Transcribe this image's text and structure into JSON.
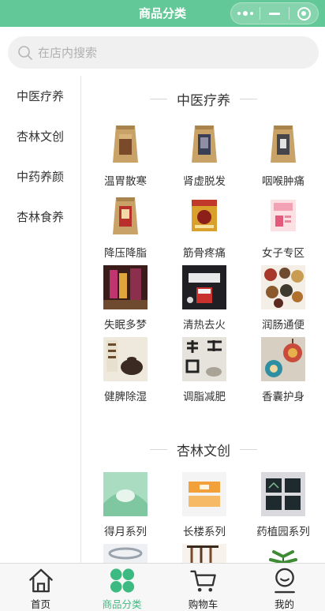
{
  "header": {
    "title": "商品分类"
  },
  "search": {
    "placeholder": "在店内搜索"
  },
  "sidebar": {
    "items": [
      {
        "label": "中医疗养"
      },
      {
        "label": "杏林文创"
      },
      {
        "label": "中药养颜"
      },
      {
        "label": "杏林食养"
      }
    ]
  },
  "sections": [
    {
      "title": "中医疗养",
      "items": [
        {
          "label": "温胃散寒",
          "icon": "herbal-tea-bag-icon"
        },
        {
          "label": "肾虚脱发",
          "icon": "herbal-tea-bag-icon"
        },
        {
          "label": "咽喉肿痛",
          "icon": "herbal-tea-bag-icon"
        },
        {
          "label": "降压降脂",
          "icon": "herbal-tea-bag-icon"
        },
        {
          "label": "筋骨疼痛",
          "icon": "medicine-box-icon"
        },
        {
          "label": "女子专区",
          "icon": "pink-box-icon"
        },
        {
          "label": "失眠多梦",
          "icon": "incense-photo-icon"
        },
        {
          "label": "清热去火",
          "icon": "tea-product-photo-icon"
        },
        {
          "label": "润肠通便",
          "icon": "dried-herbs-photo-icon"
        },
        {
          "label": "健脾除湿",
          "icon": "teapot-photo-icon"
        },
        {
          "label": "调脂减肥",
          "icon": "calligraphy-photo-icon"
        },
        {
          "label": "香囊护身",
          "icon": "sachet-photo-icon"
        }
      ]
    },
    {
      "title": "杏林文创",
      "items": [
        {
          "label": "得月系列",
          "icon": "green-artwork-icon"
        },
        {
          "label": "长楼系列",
          "icon": "orange-gift-box-icon"
        },
        {
          "label": "药植园系列",
          "icon": "dark-cards-icon"
        },
        {
          "label": "",
          "icon": "bracelet-photo-icon"
        },
        {
          "label": "",
          "icon": "brush-photo-icon"
        },
        {
          "label": "",
          "icon": "green-plant-icon"
        }
      ]
    }
  ],
  "tabbar": {
    "tabs": [
      {
        "label": "首页",
        "icon": "home-icon"
      },
      {
        "label": "商品分类",
        "icon": "category-grid-icon"
      },
      {
        "label": "购物车",
        "icon": "cart-icon"
      },
      {
        "label": "我的",
        "icon": "user-icon"
      }
    ]
  },
  "colors": {
    "accent": "#63c898",
    "active_tab": "#3dba81"
  }
}
